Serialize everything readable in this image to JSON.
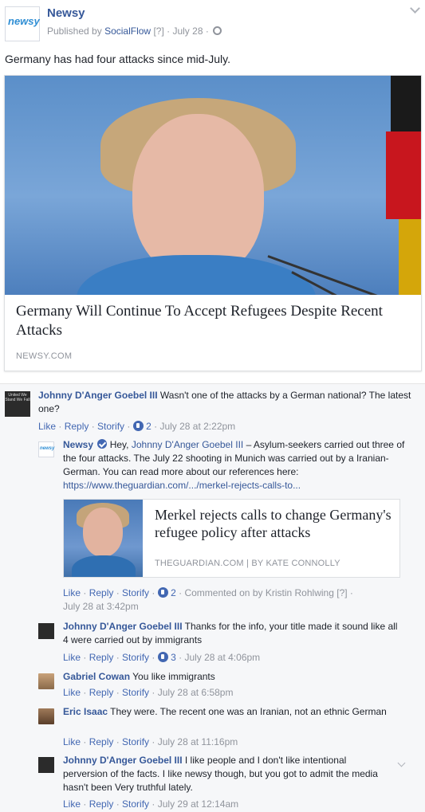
{
  "post": {
    "page_name": "Newsy",
    "logo_text": "newsy",
    "published_by_prefix": "Published by",
    "published_by": "SocialFlow",
    "help_marker": "[?]",
    "date": "July 28",
    "separator": "·",
    "text": "Germany has had four attacks since mid-July.",
    "link": {
      "title": "Germany Will Continue To Accept Refugees Despite Recent Attacks",
      "domain": "NEWSY.COM"
    }
  },
  "comments": [
    {
      "author": "Johnny D'Anger Goebel III",
      "avatar_text": "United We Stand We Fall",
      "text": "Wasn't one of the attacks by a German national? The latest one?",
      "actions": {
        "like": "Like",
        "reply": "Reply",
        "storify": "Storify",
        "likes": "2",
        "time": "July 28 at 2:22pm"
      }
    }
  ],
  "replies": [
    {
      "author": "Newsy",
      "text_prefix": "Hey,",
      "mention": "Johnny D'Anger Goebel III",
      "text": " – Asylum-seekers carried out three of the four attacks. The July 22 shooting in Munich was carried out by a Iranian-German. You can read more about our references here:",
      "url": "https://www.theguardian.com/.../merkel-rejects-calls-to...",
      "link": {
        "title": "Merkel rejects calls to change Germany's refugee policy after attacks",
        "domain": "THEGUARDIAN.COM",
        "byline": "BY KATE CONNOLLY",
        "divider": "|"
      },
      "actions": {
        "like": "Like",
        "reply": "Reply",
        "storify": "Storify",
        "likes": "2",
        "commented_by": "Commented on by",
        "commented_by_name": "Kristin Rohlwing",
        "help": "[?]",
        "time": "July 28 at 3:42pm"
      }
    },
    {
      "author": "Johnny D'Anger Goebel III",
      "text": "Thanks for the info, your title made it sound like all 4 were carried out by immigrants",
      "actions": {
        "like": "Like",
        "reply": "Reply",
        "storify": "Storify",
        "likes": "3",
        "time": "July 28 at 4:06pm"
      }
    },
    {
      "author": "Gabriel Cowan",
      "text": "You like immigrants",
      "actions": {
        "like": "Like",
        "reply": "Reply",
        "storify": "Storify",
        "time": "July 28 at 6:58pm"
      }
    },
    {
      "author": "Eric Isaac",
      "text": "They were. The recent one was an Iranian, not an ethnic German",
      "actions": {
        "like": "Like",
        "reply": "Reply",
        "storify": "Storify",
        "time": "July 28 at 11:16pm"
      }
    },
    {
      "author": "Johnny D'Anger Goebel III",
      "text": "I like people and I don't like intentional perversion of the facts. I like newsy though, but you got to admit the media hasn't been Very truthful lately.",
      "actions": {
        "like": "Like",
        "reply": "Reply",
        "storify": "Storify",
        "time": "July 29 at 12:14am"
      }
    }
  ],
  "colors": {
    "link": "#365899",
    "action": "#4267b2",
    "meta": "#90949c",
    "text": "#1d2129"
  }
}
